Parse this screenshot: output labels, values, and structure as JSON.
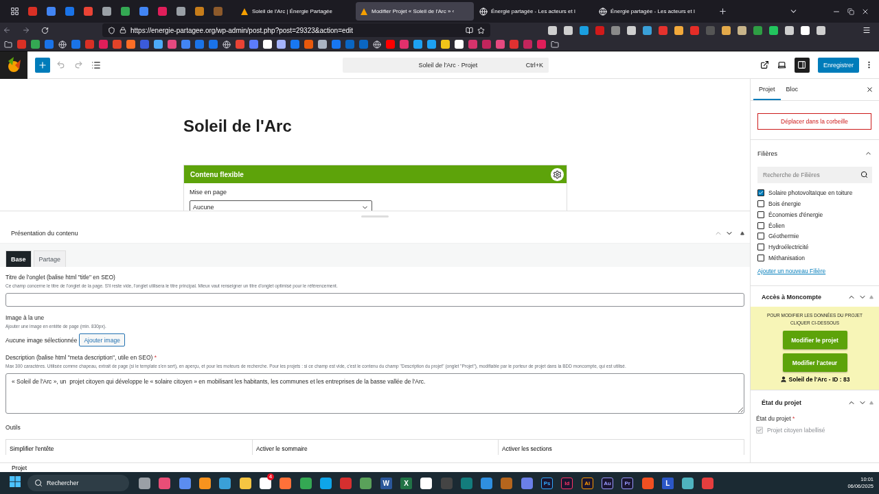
{
  "browser": {
    "pinned_tabs": [
      {
        "color": "#d93025"
      },
      {
        "color": "#4285f4"
      },
      {
        "color": "#1a73e8"
      },
      {
        "color": "#ea4335"
      },
      {
        "color": "#9aa0a6"
      },
      {
        "color": "#34a853"
      },
      {
        "color": "#4285f4"
      },
      {
        "color": "#e01e5a"
      },
      {
        "color": "#9aa0a6"
      },
      {
        "color": "#c77d1a"
      },
      {
        "color": "#8d5a2b"
      }
    ],
    "tabs": [
      {
        "kind": "site",
        "title": "Soleil de l'Arc | Énergie Partagée",
        "selected": false
      },
      {
        "kind": "site",
        "title": "Modifier Projet « Soleil de l'Arc » ‹",
        "selected": true
      },
      {
        "kind": "globe",
        "title": "Énergie partagée - Les acteurs et l",
        "selected": false
      },
      {
        "kind": "globe",
        "title": "Énergie partagée - Les acteurs et l",
        "selected": false
      }
    ],
    "url": "https://energie-partagee.org/wp-admin/post.php?post=29323&action=edit",
    "extensions": [
      {
        "color": "#cfcfcf"
      },
      {
        "color": "#cfcfcf"
      },
      {
        "color": "#1a9fe0"
      },
      {
        "color": "#d11a1a"
      },
      {
        "color": "#8a8a8a"
      },
      {
        "color": "#cfcfcf"
      },
      {
        "color": "#3aa0d8"
      },
      {
        "color": "#e5322d"
      },
      {
        "color": "#f2a93b"
      },
      {
        "color": "#e52d27"
      },
      {
        "color": "#555555"
      },
      {
        "color": "#e3a94a"
      },
      {
        "color": "#c8b48a"
      },
      {
        "color": "#2e9e44"
      },
      {
        "color": "#22c55e"
      },
      {
        "color": "#cfcfcf"
      },
      {
        "color": "#ffffff"
      },
      {
        "color": "#cfcfcf"
      }
    ],
    "bookmarks": [
      {
        "kind": "folder"
      },
      {
        "kind": "site",
        "color": "#d93025"
      },
      {
        "kind": "site",
        "color": "#34a853"
      },
      {
        "kind": "site",
        "color": "#1a73e8"
      },
      {
        "kind": "globe"
      },
      {
        "kind": "site",
        "color": "#1a73e8"
      },
      {
        "kind": "site",
        "color": "#d93025"
      },
      {
        "kind": "site",
        "color": "#e01e5a"
      },
      {
        "kind": "site",
        "color": "#e24329"
      },
      {
        "kind": "site",
        "color": "#fc6d26"
      },
      {
        "kind": "site",
        "color": "#3b5bdb"
      },
      {
        "kind": "site",
        "color": "#4dabf7"
      },
      {
        "kind": "site",
        "color": "#e64980"
      },
      {
        "kind": "site",
        "color": "#4285f4"
      },
      {
        "kind": "site",
        "color": "#1a73e8"
      },
      {
        "kind": "site",
        "color": "#1a73e8"
      },
      {
        "kind": "globe"
      },
      {
        "kind": "site",
        "color": "#ea4335"
      },
      {
        "kind": "site",
        "color": "#5c7cfa"
      },
      {
        "kind": "site",
        "color": "#ffffff"
      },
      {
        "kind": "site",
        "color": "#a5b4fc"
      },
      {
        "kind": "site",
        "color": "#1877f2"
      },
      {
        "kind": "site",
        "color": "#e8590c"
      },
      {
        "kind": "site",
        "color": "#aab4c3"
      },
      {
        "kind": "site",
        "color": "#1877f2"
      },
      {
        "kind": "site",
        "color": "#0a66c2"
      },
      {
        "kind": "site",
        "color": "#0a66c2"
      },
      {
        "kind": "globe"
      },
      {
        "kind": "site",
        "color": "#ff0000"
      },
      {
        "kind": "site",
        "color": "#e1306c"
      },
      {
        "kind": "site",
        "color": "#1da1f2"
      },
      {
        "kind": "site",
        "color": "#1da1f2"
      },
      {
        "kind": "site",
        "color": "#f0c419"
      },
      {
        "kind": "site",
        "color": "#ffffff"
      },
      {
        "kind": "site",
        "color": "#d6336c"
      },
      {
        "kind": "site",
        "color": "#c2255c"
      },
      {
        "kind": "site",
        "color": "#e64980"
      },
      {
        "kind": "site",
        "color": "#e03131"
      },
      {
        "kind": "site",
        "color": "#c2255c"
      },
      {
        "kind": "site",
        "color": "#e01e5a"
      },
      {
        "kind": "folder"
      }
    ]
  },
  "editor": {
    "command": "Soleil de l'Arc · Projet",
    "shortcut": "Ctrl+K",
    "save": "Enregistrer",
    "title": "Soleil de l'Arc",
    "block": {
      "title": "Contenu flexible",
      "field_label": "Mise en page",
      "select_value": "Aucune"
    }
  },
  "metabox": {
    "title": "Présentation du contenu",
    "tabs": [
      {
        "label": "Base",
        "selected": true
      },
      {
        "label": "Partage",
        "selected": false
      }
    ],
    "fields": [
      {
        "kind": "text",
        "label": "Titre de l'onglet (balise html \"title\" en SEO)",
        "hint": "Ce champ concerne le titre de l'onglet de la page. S'il reste vide, l'onglet utilisera le titre principal. Mieux vaut renseigner un titre d'onglet optimisé pour le référencement."
      },
      {
        "kind": "image",
        "label": "Image à la une",
        "hint": "Ajouter une image en entête de page (min. 830px).",
        "status": "Aucune image sélectionnée",
        "button": "Ajouter image"
      },
      {
        "kind": "textarea",
        "label": "Description (balise html \"meta description\", utile en SEO)",
        "required_mark": "*",
        "hint": "Max 300 caractères. Utilisée comme chapeau, extrait de page (si le template s'en sert), en aperçu, et pour les moteurs de recherche. Pour les projets : si ce champ est vide, c'est le contenu du champ \"Description du projet\" (onglet \"Projet\"), modifiable par le porteur de projet dans la BDD moncompte, qui est utilisé.",
        "value": "« Soleil de l'Arc », un  projet citoyen qui développe le « solaire citoyen » en mobilisant les habitants, les communes et les entreprises de la basse vallée de l'Arc."
      }
    ],
    "tools": {
      "label": "Outils",
      "columns": [
        "Simplifier l'entête",
        "Activer le sommaire",
        "Activer les sections"
      ]
    }
  },
  "sidebar": {
    "tabs": [
      {
        "label": "Projet",
        "selected": true
      },
      {
        "label": "Bloc",
        "selected": false
      }
    ],
    "trash": "Déplacer dans la corbeille",
    "filieres": {
      "title": "Filières",
      "expanded": true,
      "placeholder": "Recherche de Filières",
      "items": [
        {
          "label": "Solaire photovoltaïque en toiture",
          "checked": true
        },
        {
          "label": "Bois énergie",
          "checked": false
        },
        {
          "label": "Économies d'énergie",
          "checked": false
        },
        {
          "label": "Éolien",
          "checked": false
        },
        {
          "label": "Géothermie",
          "checked": false
        },
        {
          "label": "Hydroélectricité",
          "checked": false
        },
        {
          "label": "Méthanisation",
          "checked": false
        }
      ],
      "add_link": "Ajouter un nouveau Filière"
    },
    "moncompte": {
      "title": "Accès à Moncompte",
      "notice": [
        "POUR MODIFIER LES DONNÉES DU PROJET",
        "CLIQUER CI-DESSOUS"
      ],
      "buttons": [
        "Modifier le projet",
        "Modifier l'acteur"
      ],
      "owner": "Soleil de l'Arc - ID : 83"
    },
    "etat": {
      "title": "État du projet",
      "field_label": "État du projet",
      "required_mark": "*",
      "option": {
        "label": "Projet citoyen labellisé",
        "checked": true,
        "disabled": true
      }
    }
  },
  "breadcrumb": "Projet",
  "taskbar": {
    "search": "Rechercher",
    "apps": [
      {
        "kind": "app",
        "color": "#9aa0a6"
      },
      {
        "kind": "app",
        "color": "#e94e77"
      },
      {
        "kind": "app",
        "color": "#5b8def"
      },
      {
        "kind": "app",
        "color": "#f7931e"
      },
      {
        "kind": "app",
        "color": "#3aa0d8"
      },
      {
        "kind": "app",
        "color": "#f5c542"
      },
      {
        "kind": "app",
        "color": "#ffffff",
        "badge": "4"
      },
      {
        "kind": "app",
        "color": "#ff7139"
      },
      {
        "kind": "app",
        "color": "#34a853"
      },
      {
        "kind": "app",
        "color": "#0ea5e9"
      },
      {
        "kind": "app",
        "color": "#d62f2f"
      },
      {
        "kind": "app",
        "color": "#5aa15a"
      },
      {
        "kind": "tile",
        "label": "W",
        "color": "#2b579a"
      },
      {
        "kind": "tile",
        "label": "X",
        "color": "#217346"
      },
      {
        "kind": "app",
        "color": "#ffffff"
      },
      {
        "kind": "app",
        "color": "#444444"
      },
      {
        "kind": "app",
        "color": "#137c7c"
      },
      {
        "kind": "app",
        "color": "#2f8fe0"
      },
      {
        "kind": "app",
        "color": "#b5651d"
      },
      {
        "kind": "app",
        "color": "#6b7fe8"
      },
      {
        "kind": "badge",
        "label": "Ps",
        "color": "#31a8ff"
      },
      {
        "kind": "badge",
        "label": "Id",
        "color": "#ff3366"
      },
      {
        "kind": "badge",
        "label": "Ai",
        "color": "#ff9a00"
      },
      {
        "kind": "badge",
        "label": "Au",
        "color": "#9999ff"
      },
      {
        "kind": "badge",
        "label": "Pr",
        "color": "#9999ff"
      },
      {
        "kind": "app",
        "color": "#f25022"
      },
      {
        "kind": "tile",
        "label": "L",
        "color": "#2b57c7"
      },
      {
        "kind": "app",
        "color": "#4fb3bf"
      },
      {
        "kind": "app",
        "color": "#e53e3e"
      }
    ],
    "time": "10:01",
    "date": "06/06/2025"
  }
}
